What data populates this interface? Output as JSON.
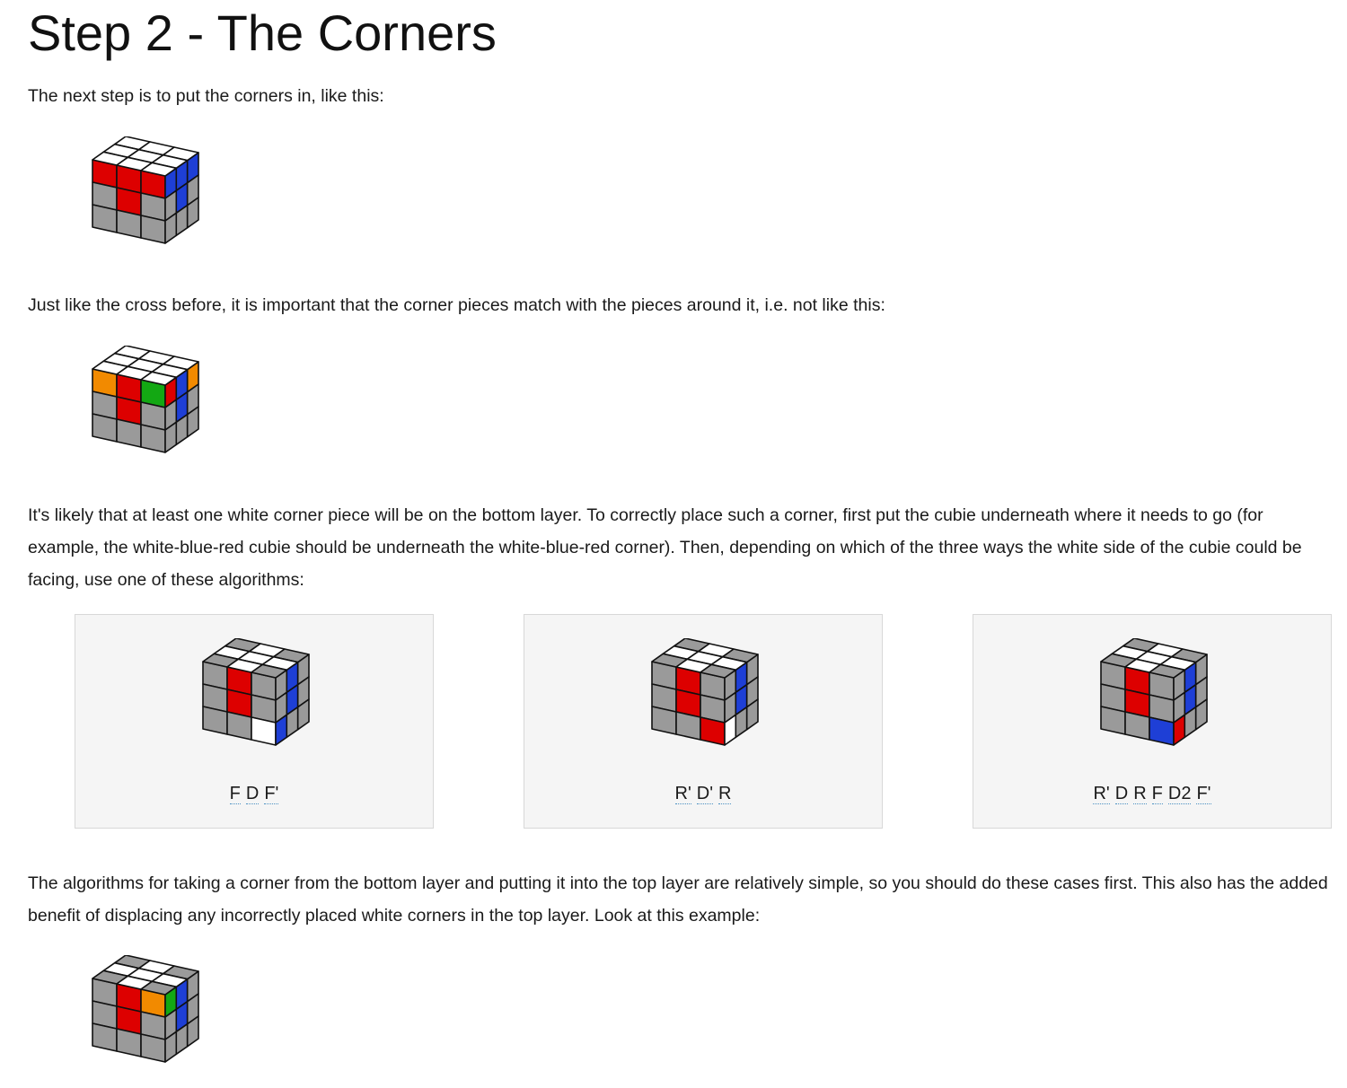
{
  "heading": "Step 2 - The Corners",
  "paragraphs": {
    "intro": "The next step is to put the corners in, like this:",
    "match": "Just like the cross before, it is important that the corner pieces match with the pieces around it, i.e. not like this:",
    "bottom_layer": "It's likely that at least one white corner piece will be on the bottom layer. To correctly place such a corner, first put the cubie underneath where it needs to go (for example, the white-blue-red cubie should be underneath the white-blue-red corner). Then, depending on which of the three ways the white side of the cubie could be facing, use one of these algorithms:",
    "example": "The algorithms for taking a corner from the bottom layer and putting it into the top layer are relatively simple, so you should do these cases first. This also has the added benefit of displacing any incorrectly placed white corners in the top layer. Look at this example:"
  },
  "colors": {
    "W": "#ffffff",
    "R": "#dd0000",
    "B": "#1e3fd6",
    "G": "#13a813",
    "O": "#f28a00",
    "X": "#9a9a9a",
    "edge": "#111111"
  },
  "cubes": {
    "goal": {
      "top": [
        "WWW",
        "WWW",
        "WWW"
      ],
      "front": [
        "RRR",
        "XRX",
        "XXX"
      ],
      "right": [
        "BBB",
        "XBX",
        "XXX"
      ]
    },
    "wrong": {
      "top": [
        "WWW",
        "WWW",
        "WWW"
      ],
      "front": [
        "ORG",
        "XRX",
        "XXX"
      ],
      "right": [
        "RBO",
        "XBX",
        "XXX"
      ]
    },
    "case1": {
      "top": [
        "XWX",
        "WWW",
        "XWX"
      ],
      "front": [
        "XRX",
        "XRX",
        "XXW"
      ],
      "right": [
        "XBX",
        "XBX",
        "BXX"
      ]
    },
    "case2": {
      "top": [
        "XWX",
        "WWW",
        "XWX"
      ],
      "front": [
        "XRX",
        "XRX",
        "XXR"
      ],
      "right": [
        "XBX",
        "XBX",
        "WXX"
      ]
    },
    "case3": {
      "top": [
        "XWX",
        "WWW",
        "XWX"
      ],
      "front": [
        "XRX",
        "XRX",
        "XXB"
      ],
      "right": [
        "XBX",
        "XBX",
        "RXX"
      ]
    },
    "example": {
      "top": [
        "XWX",
        "WWW",
        "XWX"
      ],
      "front": [
        "XRO",
        "XRX",
        "XXX"
      ],
      "right": [
        "GBX",
        "XBX",
        "XXX"
      ]
    }
  },
  "algorithms": [
    {
      "moves": [
        "F",
        "D",
        "F'"
      ]
    },
    {
      "moves": [
        "R'",
        "D'",
        "R"
      ]
    },
    {
      "moves": [
        "R'",
        "D",
        "R",
        "F",
        "D2",
        "F'"
      ]
    }
  ]
}
